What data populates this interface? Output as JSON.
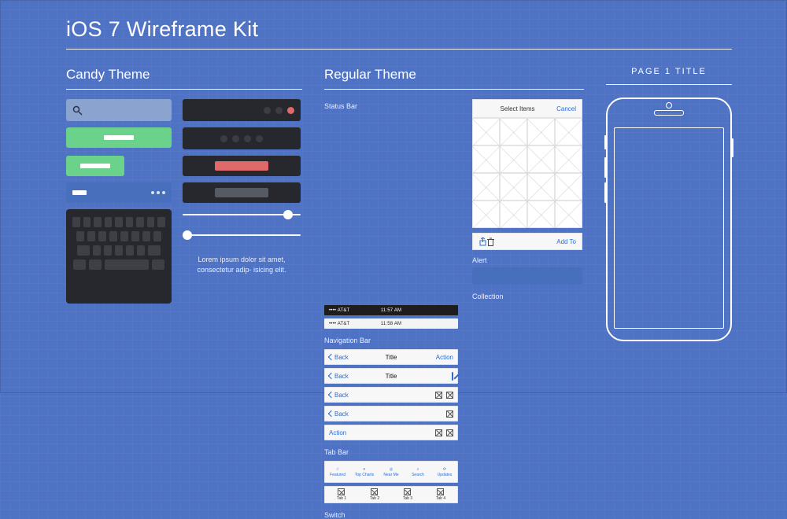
{
  "title": "iOS 7 Wireframe Kit",
  "candy": {
    "heading": "Candy Theme",
    "lorem": "Lorem ipsum dolor sit amet, consectetur adip- isicing elit."
  },
  "regular": {
    "heading": "Regular Theme",
    "labels": {
      "status_bar": "Status Bar",
      "navigation_bar": "Navigation Bar",
      "tab_bar": "Tab Bar",
      "switch": "Switch",
      "collection": "Collection",
      "alert": "Alert"
    },
    "status": {
      "carrier": "•••• AT&T",
      "time": "11:57 AM",
      "time2": "11:58 AM"
    },
    "nav": {
      "back": "Back",
      "title": "Title",
      "action": "Action"
    },
    "tabs1": [
      "Featured",
      "Top Charts",
      "Near Me",
      "Search",
      "Updates"
    ],
    "tabs2": [
      "Tab 1",
      "Tab 2",
      "Tab 3",
      "Tab 4"
    ],
    "collection_header": {
      "title": "Select Items",
      "cancel": "Cancel"
    },
    "toolbar": {
      "add_to": "Add To"
    }
  },
  "phone": {
    "page_title": "PAGE 1 TITLE"
  }
}
